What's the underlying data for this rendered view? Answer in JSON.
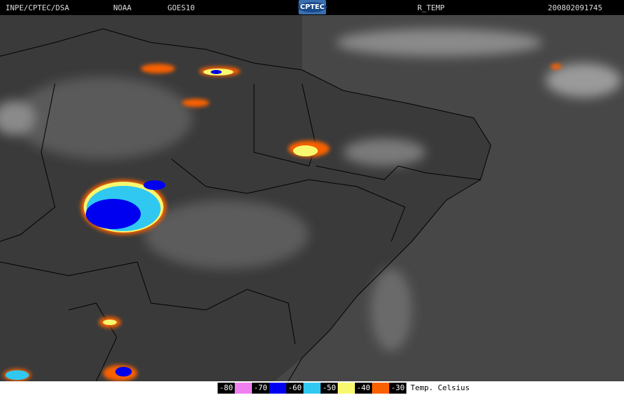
{
  "header": {
    "institution": "INPE/CPTEC/DSA",
    "agency": "NOAA",
    "satellite": "GOES10",
    "logo_text": "CPTEC",
    "product": "R_TEMP",
    "timestamp": "200802091745"
  },
  "legend": {
    "items": [
      {
        "label": "-80",
        "color": "#f080f0"
      },
      {
        "label": "-70",
        "color": "#0000f0"
      },
      {
        "label": "-60",
        "color": "#30c8f0"
      },
      {
        "label": "-50",
        "color": "#f8f870"
      },
      {
        "label": "-40",
        "color": "#f86000"
      },
      {
        "label": "-30",
        "color": ""
      }
    ],
    "unit": "Temp. Celsius"
  }
}
